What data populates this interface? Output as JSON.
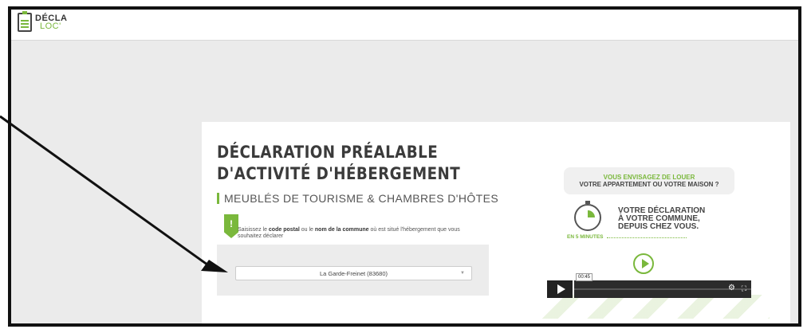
{
  "logo": {
    "line1": "DÉCLA",
    "line2": "LOC'"
  },
  "header": {
    "title_line1": "DÉCLARATION PRÉALABLE",
    "title_line2": "D'ACTIVITÉ D'HÉBERGEMENT",
    "subtitle": "MEUBLÉS DE TOURISME & CHAMBRES D'HÔTES"
  },
  "search": {
    "marker": "!",
    "instr_pre": "Saisissez le ",
    "instr_bold1": "code postal",
    "instr_mid": " ou le ",
    "instr_bold2": "nom de la commune",
    "instr_post": " où est situé l'hébergement que vous souhaitez déclarer",
    "selected_value": "La Garde-Freinet (83680)"
  },
  "video": {
    "cloud_line1": "VOUS ENVISAGEZ DE LOUER",
    "cloud_line2": "VOTRE APPARTEMENT OU VOTRE MAISON ?",
    "main_line1": "VOTRE DÉCLARATION",
    "main_line2": "À VOTRE COMMUNE,",
    "main_line3": "DEPUIS CHEZ VOUS.",
    "five_minutes": "EN 5 MINUTES",
    "time": "00:45",
    "gear": "⚙",
    "fullscreen": "⛶"
  },
  "colors": {
    "accent": "#7ab83c",
    "text": "#3b3b3b",
    "background": "#ebebeb"
  }
}
